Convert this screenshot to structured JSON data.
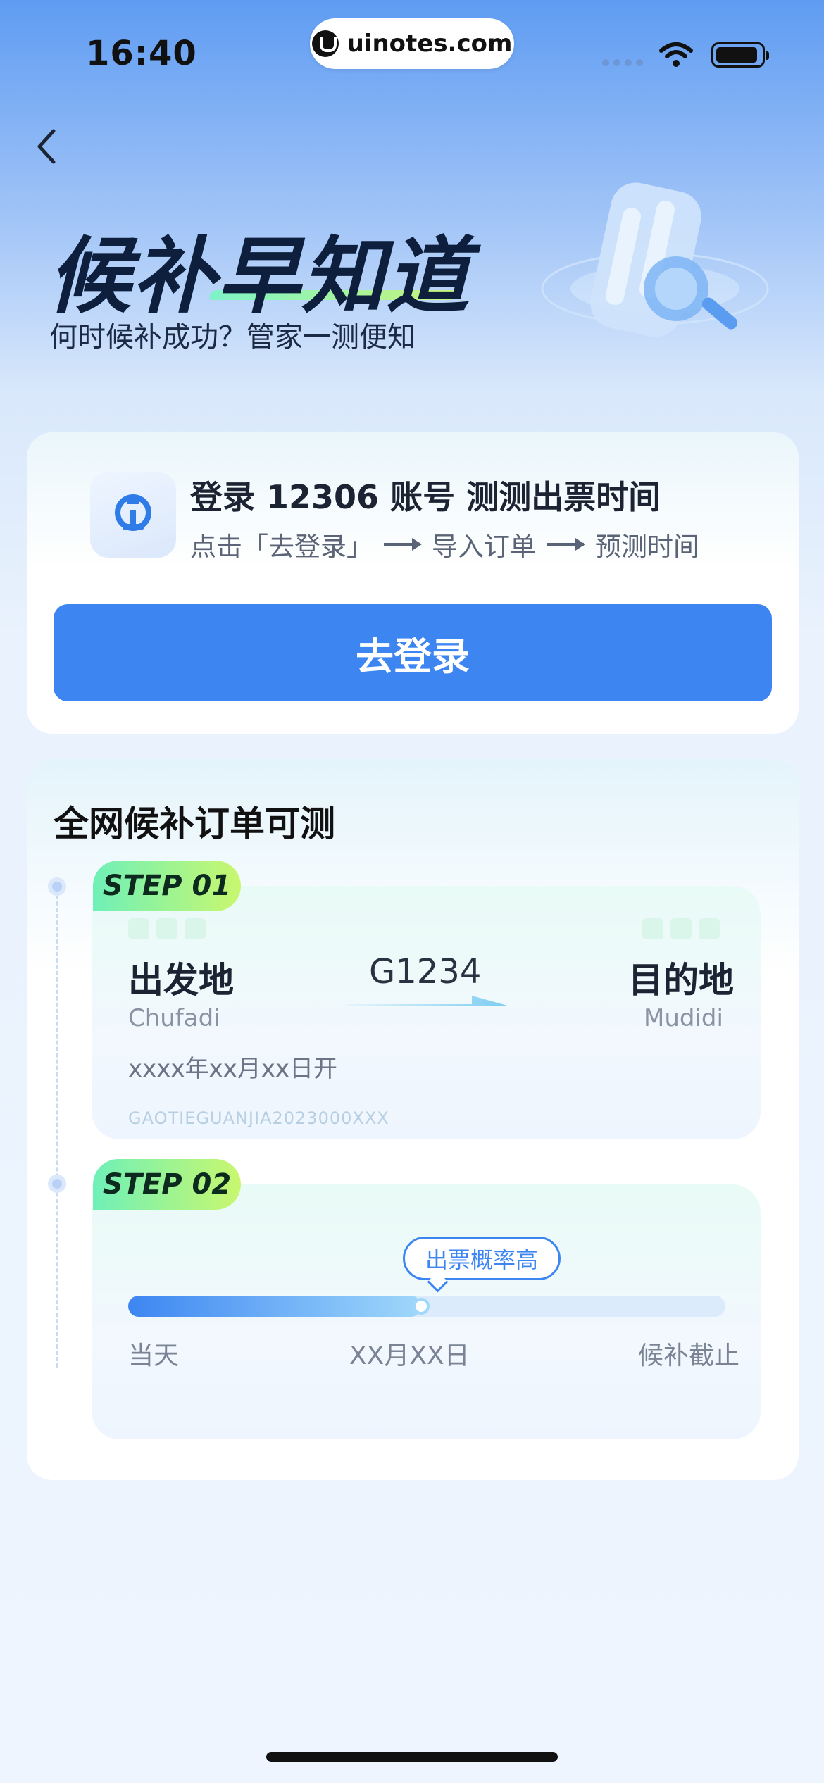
{
  "status_bar": {
    "time": "16:40",
    "site_label": "uinotes.com"
  },
  "hero": {
    "title": "候补早知道",
    "subtitle": "何时候补成功？管家一测便知"
  },
  "login_card": {
    "title": "登录 12306 账号 测测出票时间",
    "steps": [
      "点击「去登录」",
      "导入订单",
      "预测时间"
    ],
    "button_label": "去登录"
  },
  "section": {
    "title": "全网候补订单可测",
    "step1": {
      "tag": "STEP 01",
      "from": "出发地",
      "from_pinyin": "Chufadi",
      "train": "G1234",
      "to": "目的地",
      "to_pinyin": "Mudidi",
      "date": "xxxx年xx月xx日开",
      "code": "GAOTIEGUANJIA2023000XXX"
    },
    "step2": {
      "tag": "STEP 02",
      "bubble": "出票概率高",
      "progress": 0.49,
      "label_start": "当天",
      "label_mid": "XX月XX日",
      "label_end": "候补截止"
    }
  },
  "colors": {
    "primary": "#3d86f2",
    "step_tag_start": "#6ff0b8",
    "step_tag_end": "#c9f76e"
  }
}
